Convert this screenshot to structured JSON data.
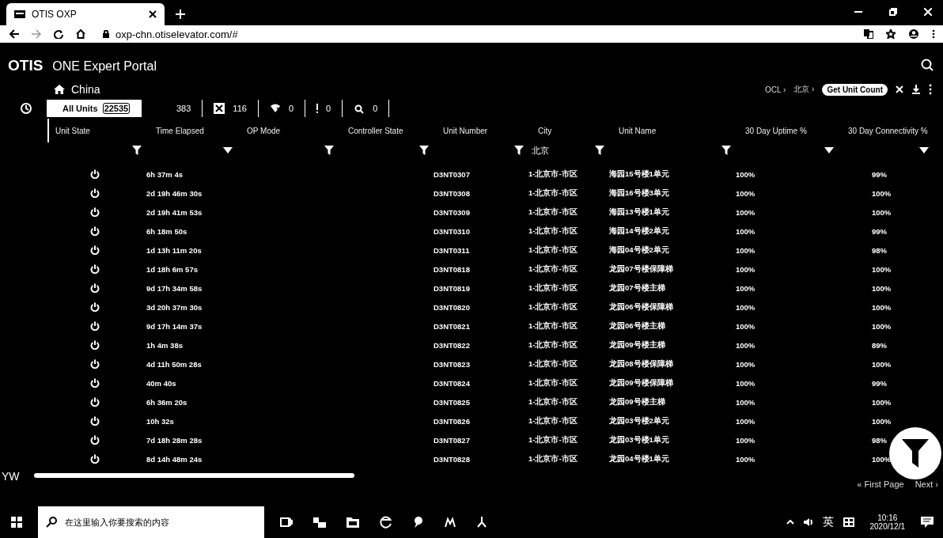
{
  "browser": {
    "tab_title": "OTIS OXP",
    "url": "oxp-chn.otiselevator.com/#"
  },
  "app": {
    "logo": "OTIS",
    "title": "ONE Expert Portal"
  },
  "breadcrumb": {
    "location": "China",
    "trail": [
      "OCL ›",
      "北京 ›"
    ],
    "chip": "Get Unit Count"
  },
  "counts": [
    {
      "kind": "all",
      "label": "All Units",
      "count": "22535",
      "selected": true
    },
    {
      "kind": "plain",
      "count": "383",
      "selected": false
    },
    {
      "kind": "tools",
      "count": "116",
      "selected": false
    },
    {
      "kind": "wifi",
      "count": "0",
      "selected": false
    },
    {
      "kind": "alert",
      "count": "0",
      "selected": false
    },
    {
      "kind": "search",
      "count": "0",
      "selected": false
    }
  ],
  "table": {
    "columns": [
      {
        "label": "Unit State",
        "kind": "funnel"
      },
      {
        "label": "Time Elapsed",
        "kind": "caret"
      },
      {
        "label": "OP Mode",
        "kind": "funnel"
      },
      {
        "label": "Controller State",
        "kind": "funnel"
      },
      {
        "label": "Unit Number",
        "kind": "funnel"
      },
      {
        "label": "City",
        "kind": "funnel",
        "filter_value": "北京"
      },
      {
        "label": "Unit Name",
        "kind": "funnel"
      },
      {
        "label": "30 Day Uptime %",
        "kind": "caret"
      },
      {
        "label": "30 Day Connectivity %",
        "kind": "caret"
      }
    ],
    "rows": [
      {
        "time": "6h 37m 4s",
        "unit": "D3NT0307",
        "city": "1-北京市-市区",
        "name": "海园15号楼1单元",
        "uptime": "100%",
        "conn": "99%"
      },
      {
        "time": "2d 19h 46m 30s",
        "unit": "D3NT0308",
        "city": "1-北京市-市区",
        "name": "海园16号楼3单元",
        "uptime": "100%",
        "conn": "100%"
      },
      {
        "time": "2d 19h 41m 53s",
        "unit": "D3NT0309",
        "city": "1-北京市-市区",
        "name": "海园13号楼1单元",
        "uptime": "100%",
        "conn": "100%"
      },
      {
        "time": "6h 18m 50s",
        "unit": "D3NT0310",
        "city": "1-北京市-市区",
        "name": "海园14号楼2单元",
        "uptime": "100%",
        "conn": "99%"
      },
      {
        "time": "1d 13h 11m 20s",
        "unit": "D3NT0311",
        "city": "1-北京市-市区",
        "name": "海园04号楼2单元",
        "uptime": "100%",
        "conn": "98%"
      },
      {
        "time": "1d 18h 6m 57s",
        "unit": "D3NT0818",
        "city": "1-北京市-市区",
        "name": "龙园07号楼保障梯",
        "uptime": "100%",
        "conn": "100%"
      },
      {
        "time": "9d 17h 34m 58s",
        "unit": "D3NT0819",
        "city": "1-北京市-市区",
        "name": "龙园07号楼主梯",
        "uptime": "100%",
        "conn": "100%"
      },
      {
        "time": "3d 20h 37m 30s",
        "unit": "D3NT0820",
        "city": "1-北京市-市区",
        "name": "龙园06号楼保障梯",
        "uptime": "100%",
        "conn": "100%"
      },
      {
        "time": "9d 17h 14m 37s",
        "unit": "D3NT0821",
        "city": "1-北京市-市区",
        "name": "龙园06号楼主梯",
        "uptime": "100%",
        "conn": "100%"
      },
      {
        "time": "1h 4m 38s",
        "unit": "D3NT0822",
        "city": "1-北京市-市区",
        "name": "龙园09号楼主梯",
        "uptime": "100%",
        "conn": "89%"
      },
      {
        "time": "4d 11h 50m 28s",
        "unit": "D3NT0823",
        "city": "1-北京市-市区",
        "name": "龙园08号楼保障梯",
        "uptime": "100%",
        "conn": "100%"
      },
      {
        "time": "40m 40s",
        "unit": "D3NT0824",
        "city": "1-北京市-市区",
        "name": "龙园09号楼保障梯",
        "uptime": "100%",
        "conn": "99%"
      },
      {
        "time": "6h 36m 20s",
        "unit": "D3NT0825",
        "city": "1-北京市-市区",
        "name": "龙园09号楼主梯",
        "uptime": "100%",
        "conn": "100%"
      },
      {
        "time": "10h 32s",
        "unit": "D3NT0826",
        "city": "1-北京市-市区",
        "name": "龙园03号楼2单元",
        "uptime": "100%",
        "conn": "100%"
      },
      {
        "time": "7d 18h 28m 28s",
        "unit": "D3NT0827",
        "city": "1-北京市-市区",
        "name": "龙园03号楼1单元",
        "uptime": "100%",
        "conn": "98%"
      },
      {
        "time": "8d 14h 48m 24s",
        "unit": "D3NT0828",
        "city": "1-北京市-市区",
        "name": "龙园04号楼1单元",
        "uptime": "100%",
        "conn": "100%"
      }
    ]
  },
  "footer": {
    "user": "YW",
    "first_page": "« First Page",
    "next": "Next ›"
  },
  "taskbar": {
    "search_placeholder": "在这里输入你要搜索的内容",
    "ime": "英",
    "time": "10:16",
    "date": "2020/12/1"
  }
}
